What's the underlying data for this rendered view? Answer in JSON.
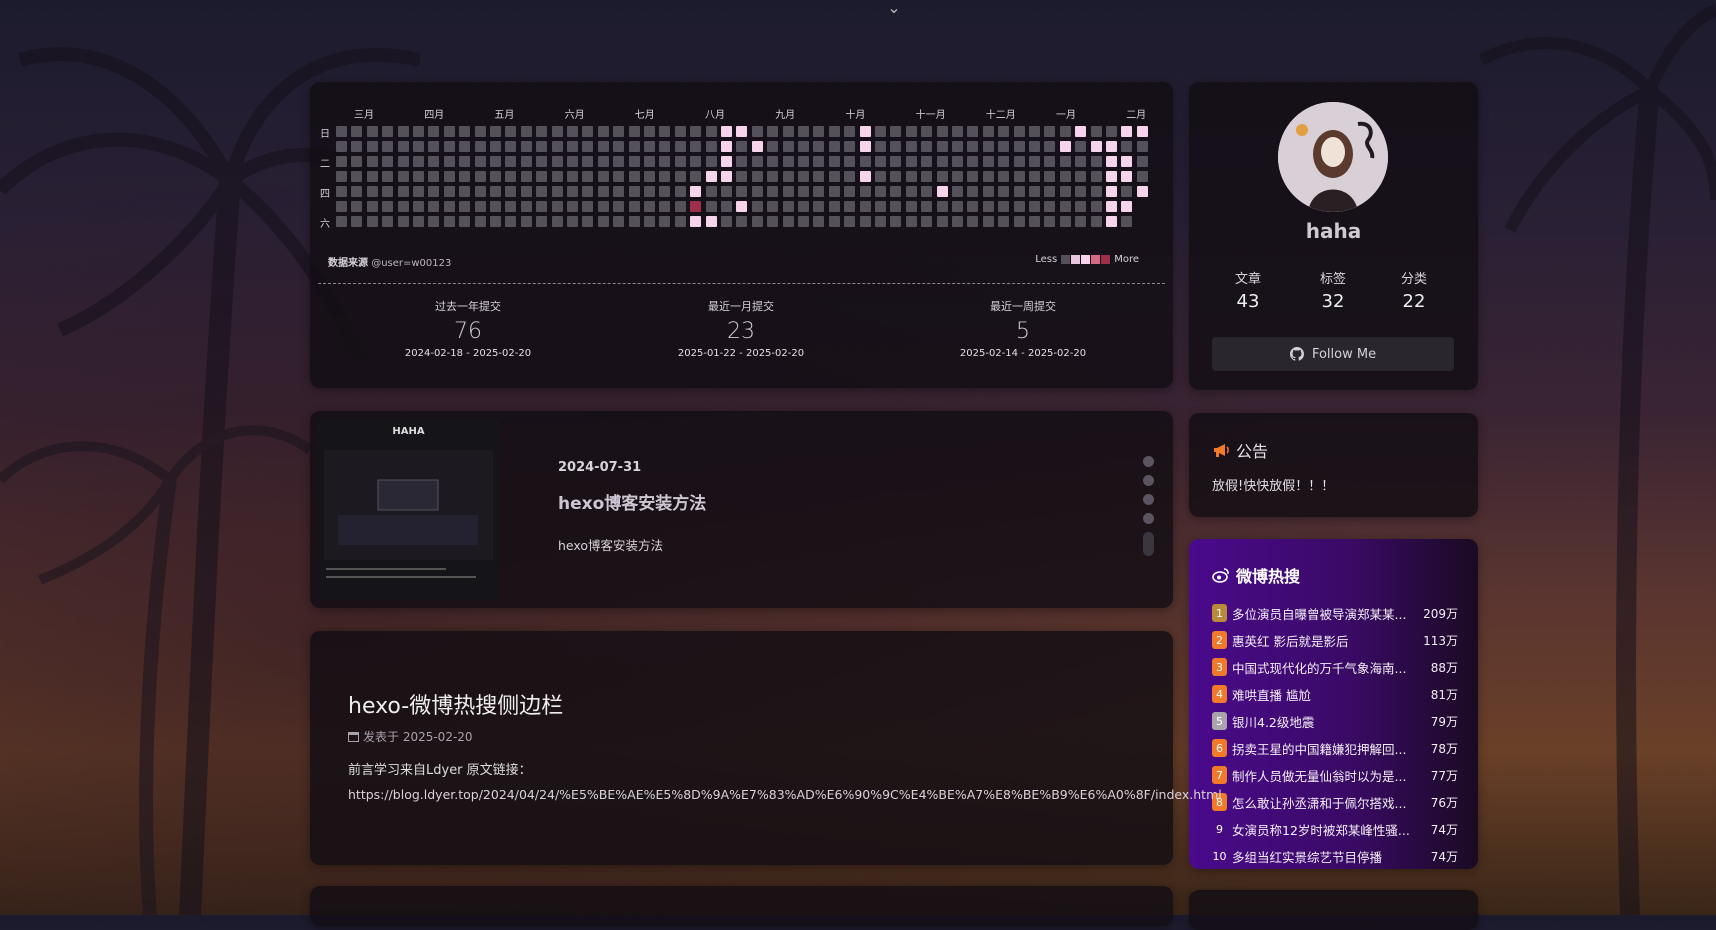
{
  "heatmap": {
    "months": [
      "三月",
      "四月",
      "五月",
      "六月",
      "七月",
      "八月",
      "九月",
      "十月",
      "十一月",
      "十二月",
      "一月",
      "二月"
    ],
    "weekdays": [
      "日",
      "二",
      "四",
      "六"
    ],
    "source_label": "数据来源",
    "source_user": "@user=w00123",
    "legend_less": "Less",
    "legend_more": "More",
    "legend_colors": [
      "#55515a",
      "#e8c6dc",
      "#f6d4ec",
      "#d46a86",
      "#9e2e4a"
    ],
    "stats": [
      {
        "title": "过去一年提交",
        "value": "76",
        "range": "2024-02-18 - 2025-02-20"
      },
      {
        "title": "最近一月提交",
        "value": "23",
        "range": "2025-01-22 - 2025-02-20"
      },
      {
        "title": "最近一周提交",
        "value": "5",
        "range": "2025-02-14 - 2025-02-20"
      }
    ],
    "active_cells": [
      [
        25,
        0
      ],
      [
        26,
        0
      ],
      [
        34,
        0
      ],
      [
        48,
        0
      ],
      [
        51,
        0
      ],
      [
        52,
        0
      ],
      [
        25,
        1
      ],
      [
        27,
        1
      ],
      [
        34,
        1
      ],
      [
        47,
        1
      ],
      [
        49,
        1
      ],
      [
        50,
        1
      ],
      [
        25,
        2
      ],
      [
        50,
        2
      ],
      [
        51,
        2
      ],
      [
        24,
        3
      ],
      [
        25,
        3
      ],
      [
        34,
        3
      ],
      [
        50,
        3
      ],
      [
        51,
        3
      ],
      [
        23,
        4
      ],
      [
        39,
        4
      ],
      [
        50,
        4
      ],
      [
        52,
        4
      ],
      [
        23,
        5
      ],
      [
        26,
        5
      ],
      [
        50,
        5
      ],
      [
        51,
        5
      ],
      [
        23,
        6
      ],
      [
        24,
        6
      ],
      [
        50,
        6
      ]
    ],
    "dark_cells": [
      [
        23,
        5
      ]
    ]
  },
  "profile": {
    "name": "haha",
    "stats": [
      {
        "label": "文章",
        "value": "43"
      },
      {
        "label": "标签",
        "value": "32"
      },
      {
        "label": "分类",
        "value": "22"
      }
    ],
    "follow_label": "Follow Me"
  },
  "notice": {
    "title": "公告",
    "text": "放假!快快放假！！！"
  },
  "weibo": {
    "title": "微博热搜",
    "items": [
      {
        "rank": "1",
        "title": "多位演员自曝曾被导演郑某某...",
        "heat": "209万",
        "color": "#b88a3a"
      },
      {
        "rank": "2",
        "title": "惠英红 影后就是影后",
        "heat": "113万",
        "color": "#f07a2a"
      },
      {
        "rank": "3",
        "title": "中国式现代化的万千气象海南...",
        "heat": "88万",
        "color": "#f07a2a"
      },
      {
        "rank": "4",
        "title": "难哄直播 尴尬",
        "heat": "81万",
        "color": "#f07a2a"
      },
      {
        "rank": "5",
        "title": "银川4.2级地震",
        "heat": "79万",
        "color": "#a9a4ac"
      },
      {
        "rank": "6",
        "title": "拐卖王星的中国籍嫌犯押解回...",
        "heat": "78万",
        "color": "#f07a2a"
      },
      {
        "rank": "7",
        "title": "制作人员做无量仙翁时以为是...",
        "heat": "77万",
        "color": "#f07a2a"
      },
      {
        "rank": "8",
        "title": "怎么敢让孙丞潇和于佩尔搭戏...",
        "heat": "76万",
        "color": "#f07a2a"
      },
      {
        "rank": "9",
        "title": "女演员称12岁时被郑某峰性骚...",
        "heat": "74万",
        "color": "transparent"
      },
      {
        "rank": "10",
        "title": "多组当红实景综艺节目停播",
        "heat": "74万",
        "color": "transparent"
      }
    ]
  },
  "post1": {
    "thumb_title": "HAHA",
    "date": "2024-07-31",
    "title": "hexo博客安装方法",
    "desc": "hexo博客安装方法"
  },
  "post2": {
    "title": "hexo-微博热搜侧边栏",
    "meta": "发表于 2025-02-20",
    "preface": "前言学习来自Ldyer 原文链接：",
    "link": "https://blog.ldyer.top/2024/04/24/%E5%BE%AE%E5%8D%9A%E7%83%AD%E6%90%9C%E4%BE%A7%E8%BE%B9%E6%A0%8F/index.html"
  }
}
